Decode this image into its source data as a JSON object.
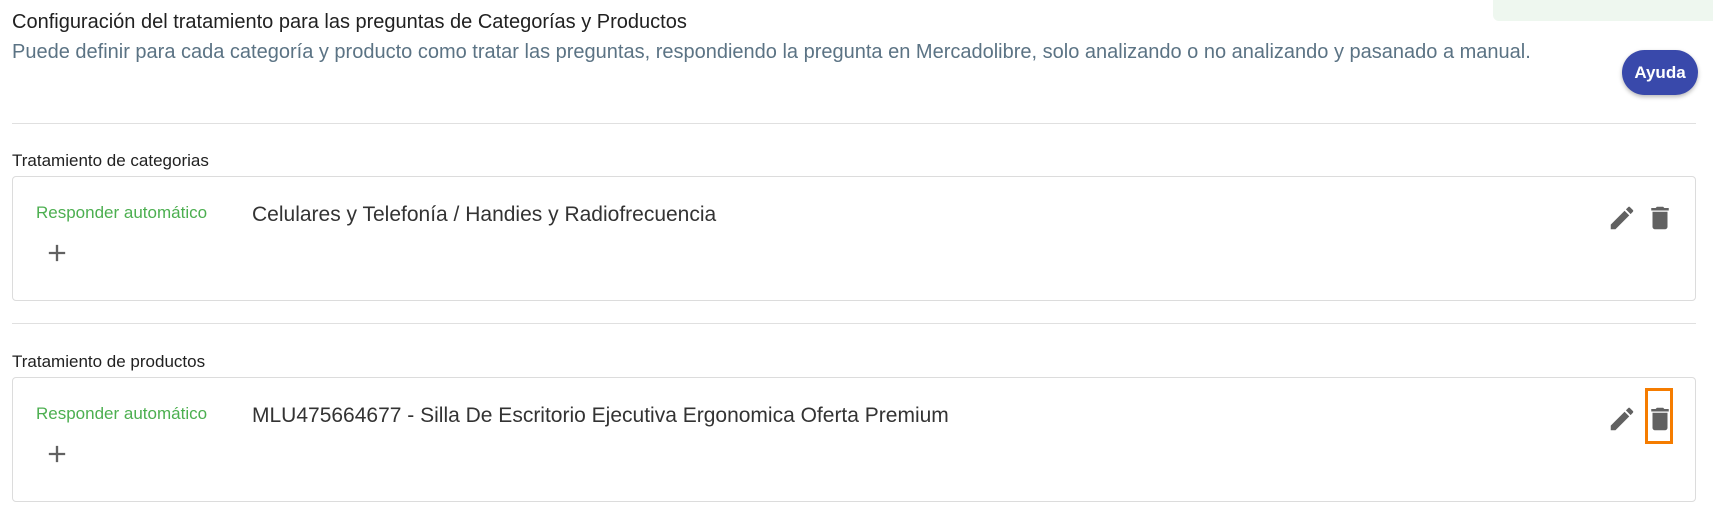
{
  "header": {
    "title": "Configuración del tratamiento para las preguntas de Categorías y Productos",
    "description": "Puede definir para cada categoría y producto como tratar las preguntas, respondiendo la pregunta en Mercadolibre, solo analizando o no analizando y pasanado a manual.",
    "help_label": "Ayuda"
  },
  "categories": {
    "label": "Tratamiento de categorias",
    "item": {
      "mode": "Responder automático",
      "name": "Celulares y Telefonía / Handies y Radiofrecuencia"
    }
  },
  "products": {
    "label": "Tratamiento de productos",
    "item": {
      "mode": "Responder automático",
      "name": "MLU475664677 - Silla De Escritorio Ejecutiva Ergonomica Oferta Premium"
    }
  },
  "icons": {
    "add": "plus-icon",
    "edit": "pencil-icon",
    "delete": "trash-icon"
  },
  "colors": {
    "accent": "#3949ab",
    "mode_text": "#4caf50",
    "description_text": "#5b7384",
    "highlight": "#f57c00"
  }
}
